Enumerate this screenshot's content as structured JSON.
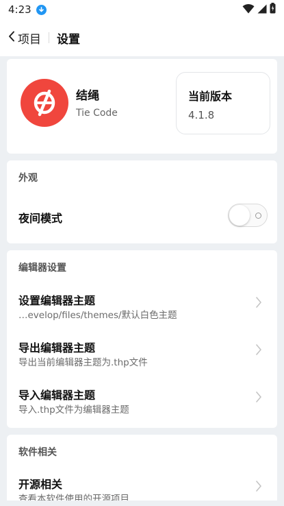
{
  "status_bar": {
    "time": "4:23"
  },
  "app_bar": {
    "back_label": "项目",
    "title": "设置"
  },
  "about": {
    "app_name": "结绳",
    "app_subtitle": "Tie Code",
    "version_label": "当前版本",
    "version_value": "4.1.8",
    "logo_color": "#f0463d"
  },
  "appearance": {
    "section_title": "外观",
    "night_mode_label": "夜间模式",
    "night_mode_on": false
  },
  "editor": {
    "section_title": "编辑器设置",
    "items": [
      {
        "title": "设置编辑器主题",
        "subtitle": "…evelop/files/themes/默认白色主题"
      },
      {
        "title": "导出编辑器主题",
        "subtitle": "导出当前编辑器主题为.thp文件"
      },
      {
        "title": "导入编辑器主题",
        "subtitle": "导入.thp文件为编辑器主题"
      }
    ]
  },
  "software": {
    "section_title": "软件相关",
    "items": [
      {
        "title": "开源相关",
        "subtitle": "查看本软件使用的开源项目"
      }
    ]
  }
}
